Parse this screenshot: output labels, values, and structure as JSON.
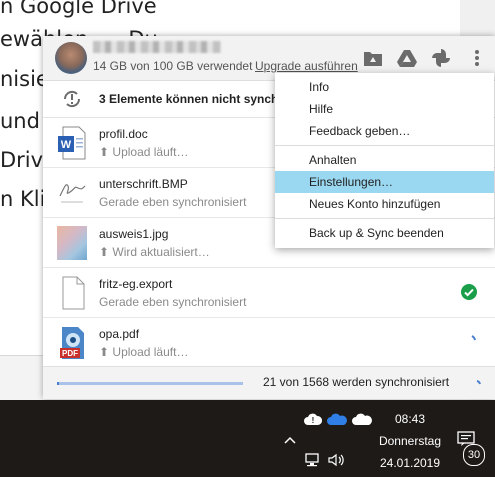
{
  "background_document": {
    "lines": [
      "n Google Drive",
      "ewählen, ... Du",
      "nisie",
      "und d",
      "Driv",
      "n Kli"
    ]
  },
  "panel": {
    "header": {
      "storage_text": "14 GB von 100 GB verwendet",
      "upgrade_link": "Upgrade ausführen",
      "icons": [
        "folder-drive-icon",
        "google-drive-icon",
        "photos-pinwheel-icon",
        "more-vert-icon"
      ]
    },
    "warning": {
      "text": "3 Elemente können nicht synchro",
      "icon": "sync-problem-icon"
    },
    "files": [
      {
        "name": "profil.doc",
        "status": "Upload läuft…",
        "status_icon": "upload-icon",
        "file_icon": "word-doc-icon"
      },
      {
        "name": "unterschrift.BMP",
        "status": "Gerade eben synchronisiert",
        "status_icon": "",
        "file_icon": "signature-image-icon"
      },
      {
        "name": "ausweis1.jpg",
        "status": "Wird aktualisiert…",
        "status_icon": "upload-icon",
        "file_icon": "photo-thumbnail-icon"
      },
      {
        "name": "fritz-eg.export",
        "status": "Gerade eben synchronisiert",
        "status_icon": "",
        "file_icon": "blank-file-icon",
        "state": "synced-check-icon"
      },
      {
        "name": "opa.pdf",
        "status": "Upload läuft…",
        "status_icon": "upload-icon",
        "file_icon": "pdf-file-icon",
        "state": "syncing-spinner-icon"
      }
    ],
    "footer": {
      "sync_text": "21 von 1568 werden synchronisiert",
      "progress": 0.013
    }
  },
  "menu": {
    "items": [
      {
        "label": "Info"
      },
      {
        "label": "Hilfe"
      },
      {
        "label": "Feedback geben…"
      },
      {
        "label": "Anhalten"
      },
      {
        "label": "Einstellungen…",
        "highlighted": true
      },
      {
        "label": "Neues Konto hinzufügen"
      },
      {
        "label": "Back up & Sync beenden"
      }
    ]
  },
  "taskbar": {
    "time": "08:43",
    "day": "Donnerstag",
    "date": "24.01.2019",
    "notification_count": "30",
    "tray_icons": [
      "backup-sync-icon",
      "onedrive-icon",
      "onedrive-personal-icon",
      "chevron-up-icon",
      "network-icon",
      "volume-icon",
      "notification-icon"
    ]
  },
  "colors": {
    "accent": "#4a7fd0",
    "menu_highlight": "#9ad7f0",
    "success": "#1a9e4a",
    "taskbar": "#1e1a17"
  }
}
